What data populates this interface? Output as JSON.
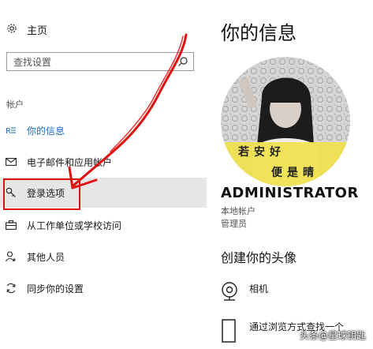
{
  "sidebar": {
    "home_label": "主页",
    "search_placeholder": "查找设置",
    "section_label": "帐户",
    "items": [
      {
        "label": "你的信息",
        "icon": "person-info-icon"
      },
      {
        "label": "电子邮件和应用帐户",
        "icon": "mail-icon"
      },
      {
        "label": "登录选项",
        "icon": "key-icon"
      },
      {
        "label": "从工作单位或学校访问",
        "icon": "briefcase-icon"
      },
      {
        "label": "其他人员",
        "icon": "person-add-icon"
      },
      {
        "label": "同步你的设置",
        "icon": "sync-icon"
      }
    ]
  },
  "main": {
    "title": "你的信息",
    "avatar_text": [
      "若安好",
      "便是晴"
    ],
    "username": "ADMINISTRATOR",
    "account_type": "本地帐户",
    "role": "管理员",
    "create_title": "创建你的头像",
    "options": [
      {
        "label": "相机",
        "icon": "camera-icon"
      },
      {
        "label": "通过浏览方式查找一个",
        "icon": "browse-icon"
      }
    ]
  },
  "watermark": "头条@星球钥匙",
  "colors": {
    "accent": "#1f6cc4",
    "annotation": "#e01010",
    "selected_bg": "#e6e6e6"
  }
}
